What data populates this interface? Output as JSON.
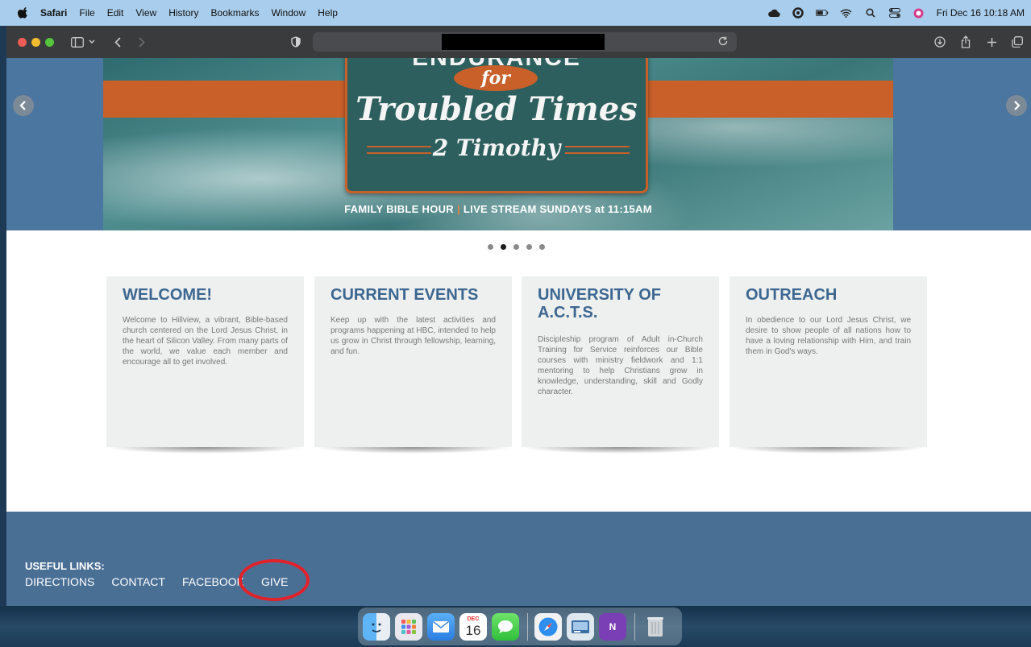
{
  "menubar": {
    "app": "Safari",
    "items": [
      "File",
      "Edit",
      "View",
      "History",
      "Bookmarks",
      "Window",
      "Help"
    ],
    "clock": "Fri Dec 16  10:18 AM",
    "status_icons": [
      "cloud-icon",
      "focus-icon",
      "battery-icon",
      "wifi-icon",
      "search-icon",
      "control-center-icon",
      "siri-icon"
    ]
  },
  "hero": {
    "poster_top": "ENDURANCE",
    "for": "for",
    "title": "Troubled Times",
    "subtitle": "2 Timothy",
    "caption_left": "FAMILY BIBLE HOUR",
    "caption_sep": "|",
    "caption_right": "LIVE STREAM SUNDAYS at 11:15AM"
  },
  "carousel": {
    "slide_count": 5,
    "active_slide": 2
  },
  "cards": [
    {
      "title": "WELCOME!",
      "body": "Welcome to Hillview, a vibrant, Bible-based church centered on the Lord Jesus Christ, in the heart of Silicon Valley. From many parts of the world, we value each member and encourage all to get involved."
    },
    {
      "title": "CURRENT EVENTS",
      "body": "Keep up with the latest activities and programs happening at HBC, intended to help us grow in Christ through fellowship, learning, and fun."
    },
    {
      "title": "UNIVERSITY OF A.C.T.S.",
      "body": "Discipleship program of Adult in-Church Training for Service reinforces our Bible courses with ministry fieldwork and 1:1 mentoring to help Christians grow in knowledge, understanding, skill and Godly character."
    },
    {
      "title": "OUTREACH",
      "body": "In obedience to our Lord Jesus Christ, we desire to show people of all nations how to have a loving relationship with Him, and train them in God's ways."
    }
  ],
  "footer": {
    "heading": "USEFUL LINKS:",
    "links": [
      "DIRECTIONS",
      "CONTACT",
      "FACEBOOK",
      "GIVE"
    ]
  },
  "dock": {
    "calendar_month": "DEC",
    "calendar_day": "16",
    "apps": [
      "finder",
      "launchpad",
      "mail",
      "calendar",
      "messages",
      "safari",
      "preview",
      "onenote",
      "trash"
    ]
  },
  "colors": {
    "accent_orange": "#c9602a",
    "heading_blue": "#3d6791",
    "footer_blue": "#4a6f95",
    "highlight_red": "#e2222a"
  }
}
